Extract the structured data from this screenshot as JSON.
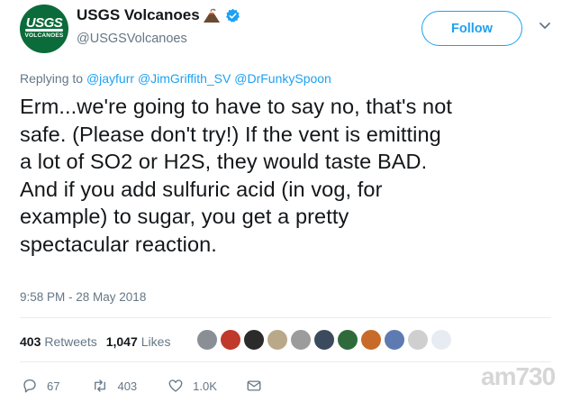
{
  "account": {
    "display_name": "USGS Volcanoes",
    "handle": "@USGSVolcanoes",
    "logo_text_top": "USGS",
    "logo_text_bottom": "VOLCANOES"
  },
  "follow_label": "Follow",
  "replying": {
    "prefix": "Replying to",
    "mentions": [
      "@jayfurr",
      "@JimGriffith_SV",
      "@DrFunkySpoon"
    ]
  },
  "tweet_lines": [
    "Erm...we're going to have to say no, that's not",
    "safe. (Please don't try!) If the vent is emitting",
    "a lot of SO2 or H2S, they would taste BAD.",
    "And if you add sulfuric acid (in vog, for",
    "example) to sugar, you get a pretty",
    "spectacular reaction."
  ],
  "timestamp": "9:58 PM - 28 May 2018",
  "stats": {
    "retweets_count": "403",
    "retweets_label": "Retweets",
    "likes_count": "1,047",
    "likes_label": "Likes"
  },
  "likers_avatar_colors": [
    "#8a8f96",
    "#c0392b",
    "#2b2b2b",
    "#b9a98a",
    "#9c9c9c",
    "#3b4a5c",
    "#2f6b3a",
    "#c86a2a",
    "#5d7bb0",
    "#cfcfcf",
    "#e7ecf2"
  ],
  "actions": {
    "reply_count": "67",
    "retweet_count": "403",
    "like_count": "1.0K"
  },
  "watermark": "am730",
  "colors": {
    "accent": "#1da1f2",
    "brand_green": "#0b6b3a",
    "muted": "#657786"
  }
}
